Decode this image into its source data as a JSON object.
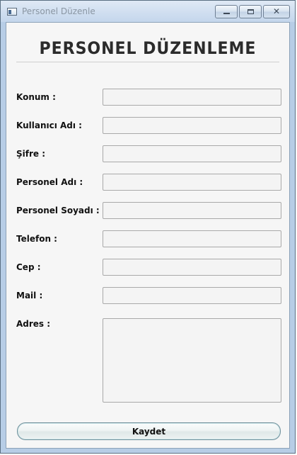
{
  "window": {
    "title": "Personel Düzenle"
  },
  "header": {
    "title": "PERSONEL DÜZENLEME"
  },
  "form": {
    "fields": [
      {
        "label": "Konum :",
        "value": ""
      },
      {
        "label": "Kullanıcı Adı :",
        "value": ""
      },
      {
        "label": "Şifre :",
        "value": ""
      },
      {
        "label": "Personel Adı :",
        "value": ""
      },
      {
        "label": "Personel Soyadı :",
        "value": ""
      },
      {
        "label": "Telefon :",
        "value": ""
      },
      {
        "label": "Cep :",
        "value": ""
      },
      {
        "label": "Mail :",
        "value": ""
      },
      {
        "label": "Adres :",
        "value": ""
      }
    ],
    "save_label": "Kaydet"
  },
  "icons": {
    "app": "application-window-icon",
    "minimize": "minimize-icon",
    "maximize": "maximize-icon",
    "close": "close-icon"
  },
  "colors": {
    "titlebar": "#c4d6ec",
    "background": "#f6f6f6",
    "field_border": "#a9a9a9",
    "button_border": "#6f8f9a"
  }
}
